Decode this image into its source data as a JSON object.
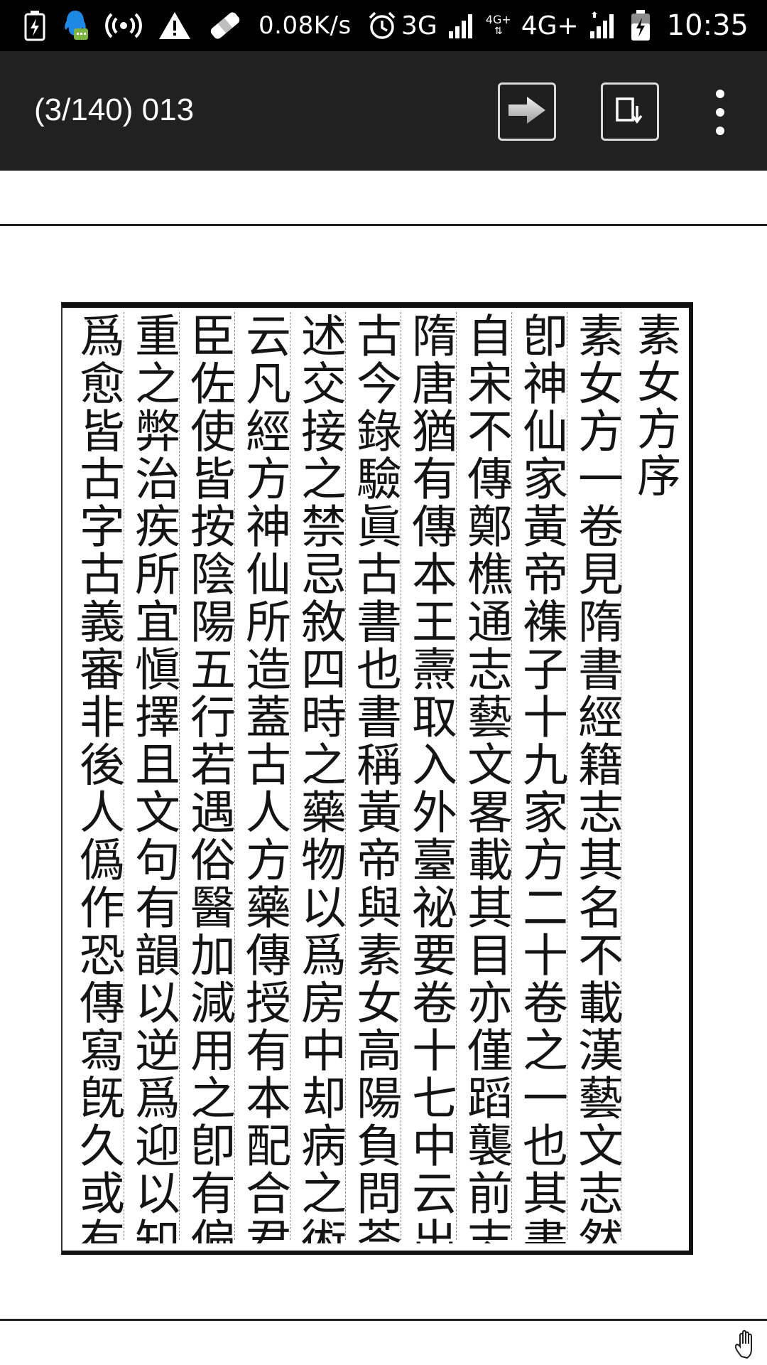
{
  "status_bar": {
    "network_speed": "0.08K/s",
    "network_3g": "3G",
    "network_4g_plus": "4G+",
    "network_4g_small": "4G+",
    "time": "10:35",
    "icons": [
      "battery-charging-icon",
      "qq-chat-icon",
      "hotspot-icon",
      "warning-icon",
      "bandage-icon",
      "alarm-icon",
      "signal-icon",
      "signal-icon-2",
      "battery-icon"
    ]
  },
  "app_bar": {
    "title": "(3/140) 013",
    "next_button_icon": "arrow-right-icon",
    "save_button_icon": "save-page-icon",
    "menu_icon": "more-vert-icon"
  },
  "document": {
    "title": "素女方序",
    "columns": [
      "素女方一卷見隋書經籍志其名不載漢藝文志然",
      "卽神仙家黃帝襍子十九家方二十卷之一也其書",
      "自宋不傳鄭樵通志藝文畧載其目亦僅蹈襲前志",
      "隋唐猶有傳本王燾取入外臺祕要卷十七中云出",
      "古今錄驗眞古書也書稱黃帝與素女高陽負問荅",
      "述交接之禁忌敘四時之藥物以爲房中却病之術",
      "云凡經方神仙所造蓋古人方藥傳授有本配合君",
      "臣佐使皆按陰陽五行若遇俗醫加減用之卽有偏",
      "重之弊治疾所宜愼擇且文句有韻以逆爲迎以知",
      "爲愈皆古字古義審非後人僞作恐傳寫旣久或有"
    ]
  },
  "footer": {
    "icon": "hand-pan-icon"
  }
}
